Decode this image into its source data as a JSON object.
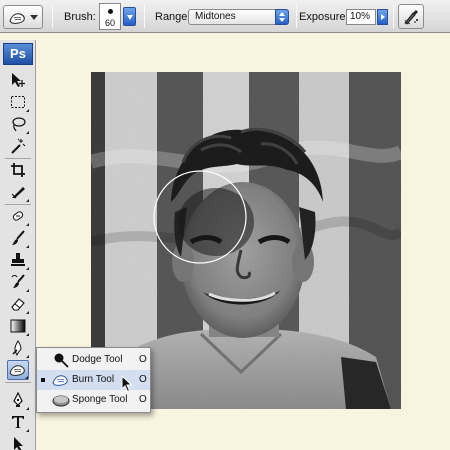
{
  "options_bar": {
    "tool_preset_icon": "burn-hand-icon",
    "brush_label": "Brush:",
    "brush_size": "60",
    "range_label": "Range:",
    "range_value": "Midtones",
    "exposure_label": "Exposure:",
    "exposure_value": "10%",
    "airbrush_icon": "airbrush-icon"
  },
  "toolbox": {
    "logo": "Ps",
    "tools": [
      "move-tool-icon",
      "marquee-tool-icon",
      "lasso-tool-icon",
      "magic-wand-icon",
      "crop-tool-icon",
      "slice-tool-icon",
      "healing-brush-icon",
      "brush-tool-icon",
      "clone-stamp-icon",
      "history-brush-icon",
      "eraser-icon",
      "gradient-icon",
      "blur-tool-icon",
      "burn-tool-icon",
      "pen-tool-icon",
      "type-tool-icon",
      "path-selection-icon"
    ],
    "active_tool": "burn-tool-icon"
  },
  "flyout": {
    "items": [
      {
        "label": "Dodge Tool",
        "shortcut": "O",
        "icon": "dodge-tool-icon",
        "selected": false
      },
      {
        "label": "Burn Tool",
        "shortcut": "O",
        "icon": "burn-tool-icon",
        "selected": true
      },
      {
        "label": "Sponge Tool",
        "shortcut": "O",
        "icon": "sponge-tool-icon",
        "selected": false
      }
    ]
  },
  "colors": {
    "workspace_bg": "#f8f4df",
    "accent_blue": "#2660c8",
    "menu_highlight": "#d3def0"
  }
}
